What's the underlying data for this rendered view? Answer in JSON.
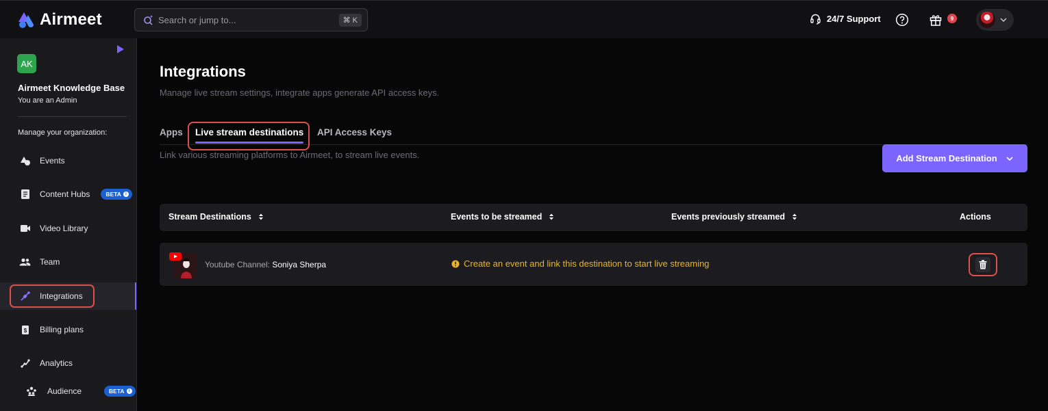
{
  "brand": {
    "name": "Airmeet"
  },
  "search": {
    "placeholder": "Search or jump to...",
    "shortcut": "⌘ K"
  },
  "header": {
    "support_label": "24/7 Support",
    "gift_count": "9"
  },
  "sidebar": {
    "org_initials": "AK",
    "org_name": "Airmeet Knowledge Base",
    "org_role": "You are an Admin",
    "manage_label": "Manage your organization:",
    "items": [
      {
        "label": "Events",
        "icon": "events-icon"
      },
      {
        "label": "Content Hubs",
        "icon": "document-icon",
        "badge": "BETA"
      },
      {
        "label": "Video Library",
        "icon": "video-camera-icon"
      },
      {
        "label": "Team",
        "icon": "team-icon"
      },
      {
        "label": "Integrations",
        "icon": "integrations-plug-icon",
        "active": true
      },
      {
        "label": "Billing plans",
        "icon": "billing-icon"
      },
      {
        "label": "Analytics",
        "icon": "analytics-icon"
      },
      {
        "label": "Audience",
        "icon": "audience-icon",
        "badge": "BETA"
      }
    ]
  },
  "page": {
    "title": "Integrations",
    "subtitle": "Manage live stream settings, integrate apps generate API access keys.",
    "tabs": [
      "Apps",
      "Live stream destinations",
      "API Access Keys"
    ],
    "active_tab": "Live stream destinations",
    "tab_description": "Link various streaming platforms to Airmeet, to stream live events.",
    "add_button": "Add Stream Destination"
  },
  "table": {
    "columns": [
      "Stream Destinations",
      "Events to be streamed",
      "Events previously streamed",
      "Actions"
    ],
    "rows": [
      {
        "channel_prefix": "Youtube Channel:",
        "channel_name": "Soniya Sherpa",
        "notice": "Create an event and link this destination to start live streaming"
      }
    ]
  },
  "colors": {
    "accent": "#7b64ff",
    "warning": "#e8b52a",
    "highlight": "#e0504a",
    "badge": "#1b5fd1"
  }
}
